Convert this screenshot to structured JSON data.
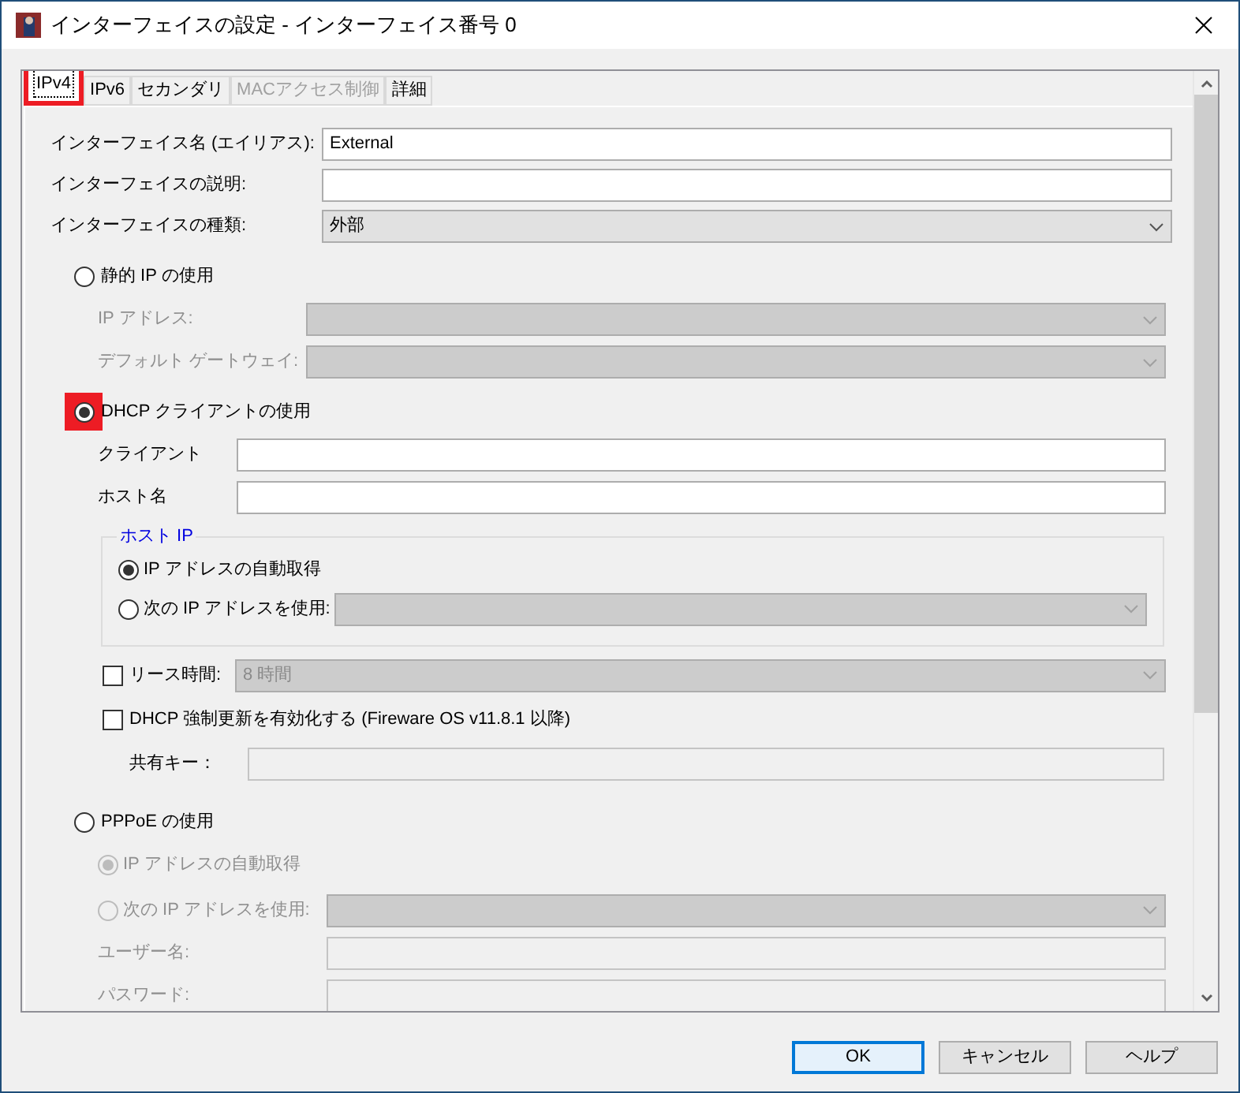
{
  "window": {
    "title": "インターフェイスの設定 - インターフェイス番号 0"
  },
  "tabs": [
    {
      "label": "IPv4",
      "selected": true,
      "disabled": false,
      "highlighted": true
    },
    {
      "label": "IPv6",
      "selected": false,
      "disabled": false,
      "highlighted": false
    },
    {
      "label": "セカンダリ",
      "selected": false,
      "disabled": false,
      "highlighted": false
    },
    {
      "label": "MACアクセス制御",
      "selected": false,
      "disabled": true,
      "highlighted": false
    },
    {
      "label": "詳細",
      "selected": false,
      "disabled": false,
      "highlighted": false
    }
  ],
  "fields": [
    {
      "label": "インターフェイス名 (エイリアス):",
      "kind": "text",
      "value": "External"
    },
    {
      "label": "インターフェイスの説明:",
      "kind": "text"
    },
    {
      "label": "インターフェイスの種類:",
      "kind": "select",
      "value": "外部"
    }
  ],
  "static_ip": {
    "label": "静的 IP の使用",
    "selected": false,
    "highlighted": false,
    "fields": [
      {
        "label": "IP アドレス:"
      },
      {
        "label": "デフォルト ゲートウェイ:"
      }
    ]
  },
  "dhcp": {
    "label": "DHCP クライアントの使用",
    "selected": true,
    "highlighted": true,
    "fields": [
      {
        "label": "クライアント"
      },
      {
        "label": "ホスト名"
      }
    ],
    "host_ip": {
      "legend": "ホスト IP",
      "options": [
        {
          "label": "IP アドレスの自動取得",
          "selected": true
        },
        {
          "label": "次の IP アドレスを使用:",
          "selected": false
        }
      ]
    },
    "lease": {
      "label": "リース時間:",
      "checked": false,
      "value": "8 時間"
    },
    "force_renew": {
      "label": "DHCP 強制更新を有効化する (Fireware OS v11.8.1 以降)",
      "checked": false
    },
    "shared_key": {
      "label": "共有キー："
    }
  },
  "pppoe": {
    "label": "PPPoE の使用",
    "selected": false,
    "highlighted": false,
    "options": [
      {
        "label": "IP アドレスの自動取得",
        "selected": true
      },
      {
        "label": "次の IP アドレスを使用:",
        "selected": false
      }
    ],
    "fields": [
      {
        "label": "ユーザー名:"
      },
      {
        "label": "パスワード:"
      }
    ]
  },
  "buttons": [
    {
      "label": "OK",
      "default": true
    },
    {
      "label": "キャンセル",
      "default": false
    },
    {
      "label": "ヘルプ",
      "default": false
    }
  ]
}
